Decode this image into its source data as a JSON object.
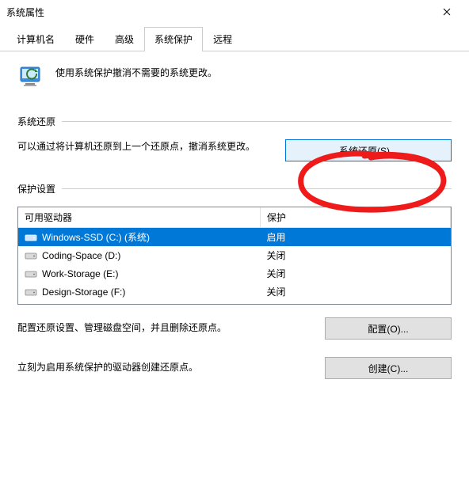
{
  "window": {
    "title": "系统属性"
  },
  "tabs": {
    "items": [
      {
        "label": "计算机名"
      },
      {
        "label": "硬件"
      },
      {
        "label": "高级"
      },
      {
        "label": "系统保护"
      },
      {
        "label": "远程"
      }
    ]
  },
  "intro": {
    "text": "使用系统保护撤消不需要的系统更改。"
  },
  "restore_section": {
    "header": "系统还原",
    "desc": "可以通过将计算机还原到上一个还原点，撤消系统更改。",
    "button": "系统还原(S)..."
  },
  "protection_section": {
    "header": "保护设置",
    "columns": {
      "drive": "可用驱动器",
      "status": "保护"
    },
    "drives": [
      {
        "name": "Windows-SSD (C:) (系统)",
        "status": "启用",
        "selected": true
      },
      {
        "name": "Coding-Space (D:)",
        "status": "关闭",
        "selected": false
      },
      {
        "name": "Work-Storage (E:)",
        "status": "关闭",
        "selected": false
      },
      {
        "name": "Design-Storage (F:)",
        "status": "关闭",
        "selected": false
      }
    ],
    "configure_desc": "配置还原设置、管理磁盘空间，并且删除还原点。",
    "configure_button": "配置(O)...",
    "create_desc": "立刻为启用系统保护的驱动器创建还原点。",
    "create_button": "创建(C)..."
  }
}
